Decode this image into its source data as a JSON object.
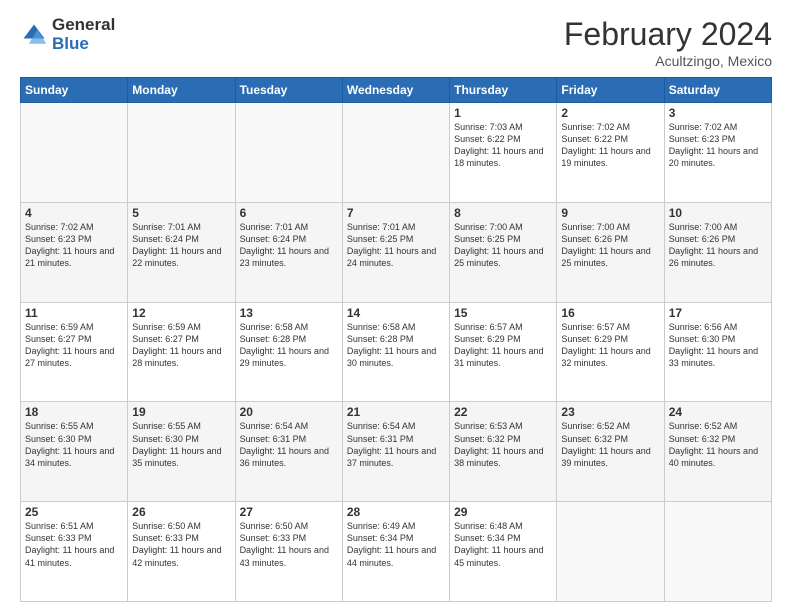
{
  "logo": {
    "general": "General",
    "blue": "Blue"
  },
  "header": {
    "month_year": "February 2024",
    "location": "Acultzingo, Mexico"
  },
  "weekdays": [
    "Sunday",
    "Monday",
    "Tuesday",
    "Wednesday",
    "Thursday",
    "Friday",
    "Saturday"
  ],
  "weeks": [
    [
      {
        "day": "",
        "sunrise": "",
        "sunset": "",
        "daylight": "",
        "empty": true
      },
      {
        "day": "",
        "sunrise": "",
        "sunset": "",
        "daylight": "",
        "empty": true
      },
      {
        "day": "",
        "sunrise": "",
        "sunset": "",
        "daylight": "",
        "empty": true
      },
      {
        "day": "",
        "sunrise": "",
        "sunset": "",
        "daylight": "",
        "empty": true
      },
      {
        "day": "1",
        "sunrise": "Sunrise: 7:03 AM",
        "sunset": "Sunset: 6:22 PM",
        "daylight": "Daylight: 11 hours and 18 minutes.",
        "empty": false
      },
      {
        "day": "2",
        "sunrise": "Sunrise: 7:02 AM",
        "sunset": "Sunset: 6:22 PM",
        "daylight": "Daylight: 11 hours and 19 minutes.",
        "empty": false
      },
      {
        "day": "3",
        "sunrise": "Sunrise: 7:02 AM",
        "sunset": "Sunset: 6:23 PM",
        "daylight": "Daylight: 11 hours and 20 minutes.",
        "empty": false
      }
    ],
    [
      {
        "day": "4",
        "sunrise": "Sunrise: 7:02 AM",
        "sunset": "Sunset: 6:23 PM",
        "daylight": "Daylight: 11 hours and 21 minutes.",
        "empty": false
      },
      {
        "day": "5",
        "sunrise": "Sunrise: 7:01 AM",
        "sunset": "Sunset: 6:24 PM",
        "daylight": "Daylight: 11 hours and 22 minutes.",
        "empty": false
      },
      {
        "day": "6",
        "sunrise": "Sunrise: 7:01 AM",
        "sunset": "Sunset: 6:24 PM",
        "daylight": "Daylight: 11 hours and 23 minutes.",
        "empty": false
      },
      {
        "day": "7",
        "sunrise": "Sunrise: 7:01 AM",
        "sunset": "Sunset: 6:25 PM",
        "daylight": "Daylight: 11 hours and 24 minutes.",
        "empty": false
      },
      {
        "day": "8",
        "sunrise": "Sunrise: 7:00 AM",
        "sunset": "Sunset: 6:25 PM",
        "daylight": "Daylight: 11 hours and 25 minutes.",
        "empty": false
      },
      {
        "day": "9",
        "sunrise": "Sunrise: 7:00 AM",
        "sunset": "Sunset: 6:26 PM",
        "daylight": "Daylight: 11 hours and 25 minutes.",
        "empty": false
      },
      {
        "day": "10",
        "sunrise": "Sunrise: 7:00 AM",
        "sunset": "Sunset: 6:26 PM",
        "daylight": "Daylight: 11 hours and 26 minutes.",
        "empty": false
      }
    ],
    [
      {
        "day": "11",
        "sunrise": "Sunrise: 6:59 AM",
        "sunset": "Sunset: 6:27 PM",
        "daylight": "Daylight: 11 hours and 27 minutes.",
        "empty": false
      },
      {
        "day": "12",
        "sunrise": "Sunrise: 6:59 AM",
        "sunset": "Sunset: 6:27 PM",
        "daylight": "Daylight: 11 hours and 28 minutes.",
        "empty": false
      },
      {
        "day": "13",
        "sunrise": "Sunrise: 6:58 AM",
        "sunset": "Sunset: 6:28 PM",
        "daylight": "Daylight: 11 hours and 29 minutes.",
        "empty": false
      },
      {
        "day": "14",
        "sunrise": "Sunrise: 6:58 AM",
        "sunset": "Sunset: 6:28 PM",
        "daylight": "Daylight: 11 hours and 30 minutes.",
        "empty": false
      },
      {
        "day": "15",
        "sunrise": "Sunrise: 6:57 AM",
        "sunset": "Sunset: 6:29 PM",
        "daylight": "Daylight: 11 hours and 31 minutes.",
        "empty": false
      },
      {
        "day": "16",
        "sunrise": "Sunrise: 6:57 AM",
        "sunset": "Sunset: 6:29 PM",
        "daylight": "Daylight: 11 hours and 32 minutes.",
        "empty": false
      },
      {
        "day": "17",
        "sunrise": "Sunrise: 6:56 AM",
        "sunset": "Sunset: 6:30 PM",
        "daylight": "Daylight: 11 hours and 33 minutes.",
        "empty": false
      }
    ],
    [
      {
        "day": "18",
        "sunrise": "Sunrise: 6:55 AM",
        "sunset": "Sunset: 6:30 PM",
        "daylight": "Daylight: 11 hours and 34 minutes.",
        "empty": false
      },
      {
        "day": "19",
        "sunrise": "Sunrise: 6:55 AM",
        "sunset": "Sunset: 6:30 PM",
        "daylight": "Daylight: 11 hours and 35 minutes.",
        "empty": false
      },
      {
        "day": "20",
        "sunrise": "Sunrise: 6:54 AM",
        "sunset": "Sunset: 6:31 PM",
        "daylight": "Daylight: 11 hours and 36 minutes.",
        "empty": false
      },
      {
        "day": "21",
        "sunrise": "Sunrise: 6:54 AM",
        "sunset": "Sunset: 6:31 PM",
        "daylight": "Daylight: 11 hours and 37 minutes.",
        "empty": false
      },
      {
        "day": "22",
        "sunrise": "Sunrise: 6:53 AM",
        "sunset": "Sunset: 6:32 PM",
        "daylight": "Daylight: 11 hours and 38 minutes.",
        "empty": false
      },
      {
        "day": "23",
        "sunrise": "Sunrise: 6:52 AM",
        "sunset": "Sunset: 6:32 PM",
        "daylight": "Daylight: 11 hours and 39 minutes.",
        "empty": false
      },
      {
        "day": "24",
        "sunrise": "Sunrise: 6:52 AM",
        "sunset": "Sunset: 6:32 PM",
        "daylight": "Daylight: 11 hours and 40 minutes.",
        "empty": false
      }
    ],
    [
      {
        "day": "25",
        "sunrise": "Sunrise: 6:51 AM",
        "sunset": "Sunset: 6:33 PM",
        "daylight": "Daylight: 11 hours and 41 minutes.",
        "empty": false
      },
      {
        "day": "26",
        "sunrise": "Sunrise: 6:50 AM",
        "sunset": "Sunset: 6:33 PM",
        "daylight": "Daylight: 11 hours and 42 minutes.",
        "empty": false
      },
      {
        "day": "27",
        "sunrise": "Sunrise: 6:50 AM",
        "sunset": "Sunset: 6:33 PM",
        "daylight": "Daylight: 11 hours and 43 minutes.",
        "empty": false
      },
      {
        "day": "28",
        "sunrise": "Sunrise: 6:49 AM",
        "sunset": "Sunset: 6:34 PM",
        "daylight": "Daylight: 11 hours and 44 minutes.",
        "empty": false
      },
      {
        "day": "29",
        "sunrise": "Sunrise: 6:48 AM",
        "sunset": "Sunset: 6:34 PM",
        "daylight": "Daylight: 11 hours and 45 minutes.",
        "empty": false
      },
      {
        "day": "",
        "sunrise": "",
        "sunset": "",
        "daylight": "",
        "empty": true
      },
      {
        "day": "",
        "sunrise": "",
        "sunset": "",
        "daylight": "",
        "empty": true
      }
    ]
  ]
}
